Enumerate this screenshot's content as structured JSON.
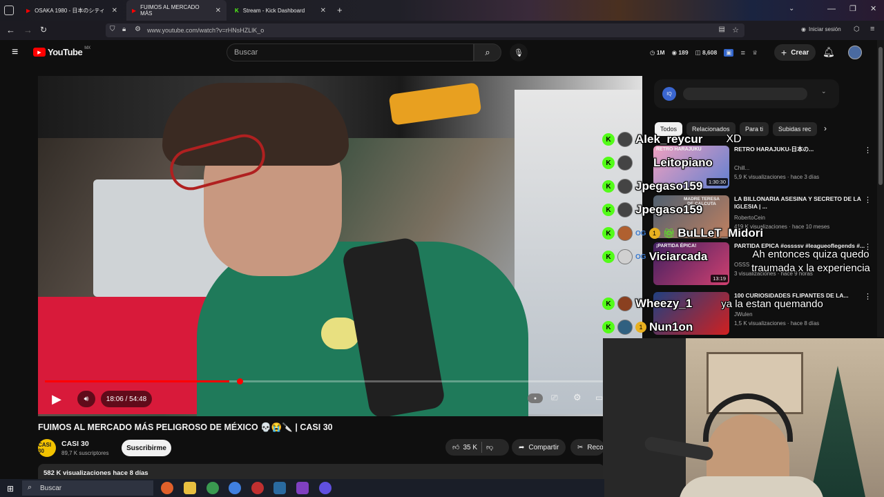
{
  "browser": {
    "tabs": [
      {
        "label": "OSAKA 1980 - 日本のシティ"
      },
      {
        "label": "FUIMOS AL MERCADO MÁS"
      },
      {
        "label": "Stream - Kick Dashboard"
      }
    ],
    "url": "www.youtube.com/watch?v=rHNsHZLlK_o",
    "signin_label": "Iniciar sesión"
  },
  "youtube": {
    "logo_text": "YouTube",
    "region": "MX",
    "search_placeholder": "Buscar",
    "stats": {
      "viewers": "1M",
      "watching": "189",
      "count": "8,608"
    },
    "create_label": "Crear"
  },
  "player": {
    "time": "18:06 / 54:48",
    "progress_fraction": 0.33
  },
  "video": {
    "title": "FUIMOS AL MERCADO MÁS PELIGROSO DE MÉXICO 💀😭🔪 | CASI 30",
    "channel": "CASI 30",
    "channel_avatar_text": "CASI 30",
    "subscribers": "89,7 K suscriptores",
    "subscribe_label": "Suscribirme",
    "likes": "35 K",
    "share_label": "Compartir",
    "clip_label": "Reco",
    "views_date": "582 K visualizaciones  hace 8 días"
  },
  "sidebar": {
    "chips": [
      "Todos",
      "Relacionados",
      "Para ti",
      "Subidas rec"
    ],
    "recommendations": [
      {
        "title": "RETRO HARAJUKU-日本の...",
        "channel": "Chill...",
        "meta": "5,9 K visualizaciones · hace 3 días",
        "duration": "1:30:30",
        "thumb_text": "RETRO HARAJUKU"
      },
      {
        "title": "LA BILLONARIA ASESINA Y SECRETO DE LA IGLESIA | ...",
        "channel": "RobertoCein",
        "meta": "419 K visualizaciones · hace 10 meses",
        "duration": "",
        "thumb_text": "MADRE TERESA DE CALCUTA"
      },
      {
        "title": "PARTIDA EPICA #ossssv #leagueoflegends #...",
        "channel": "OSSS",
        "meta": "3 visualizaciones · hace 9 horas",
        "duration": "13:19",
        "thumb_text": "¡PARTIDA ÉPICA!"
      },
      {
        "title": "100 CURIOSIDADES FLIPANTES DE LA...",
        "channel": "JWulen",
        "meta": "1,5 K visualizaciones · hace 8 días",
        "duration": "",
        "thumb_text": ""
      }
    ]
  },
  "chat": [
    {
      "user": "Alek_reycur",
      "message": "XD"
    },
    {
      "user": "Leitopiano",
      "message": ""
    },
    {
      "user": "Jpegaso159",
      "message": ""
    },
    {
      "user": "Jpegaso159",
      "message": ""
    },
    {
      "user": "BuLLeT_Midori",
      "message": ""
    },
    {
      "user": "Viciarcada",
      "message": "Ah entonces quiza quedo traumada x la experiencia"
    },
    {
      "user": "Wheezy_1",
      "message": "ya la estan quemando"
    },
    {
      "user": "Nun1on",
      "message": ""
    }
  ],
  "taskbar": {
    "search_label": "Buscar"
  },
  "colors": {
    "kick_green": "#53fc18",
    "yt_red": "#ff0000",
    "bg": "#0f0f0f"
  }
}
